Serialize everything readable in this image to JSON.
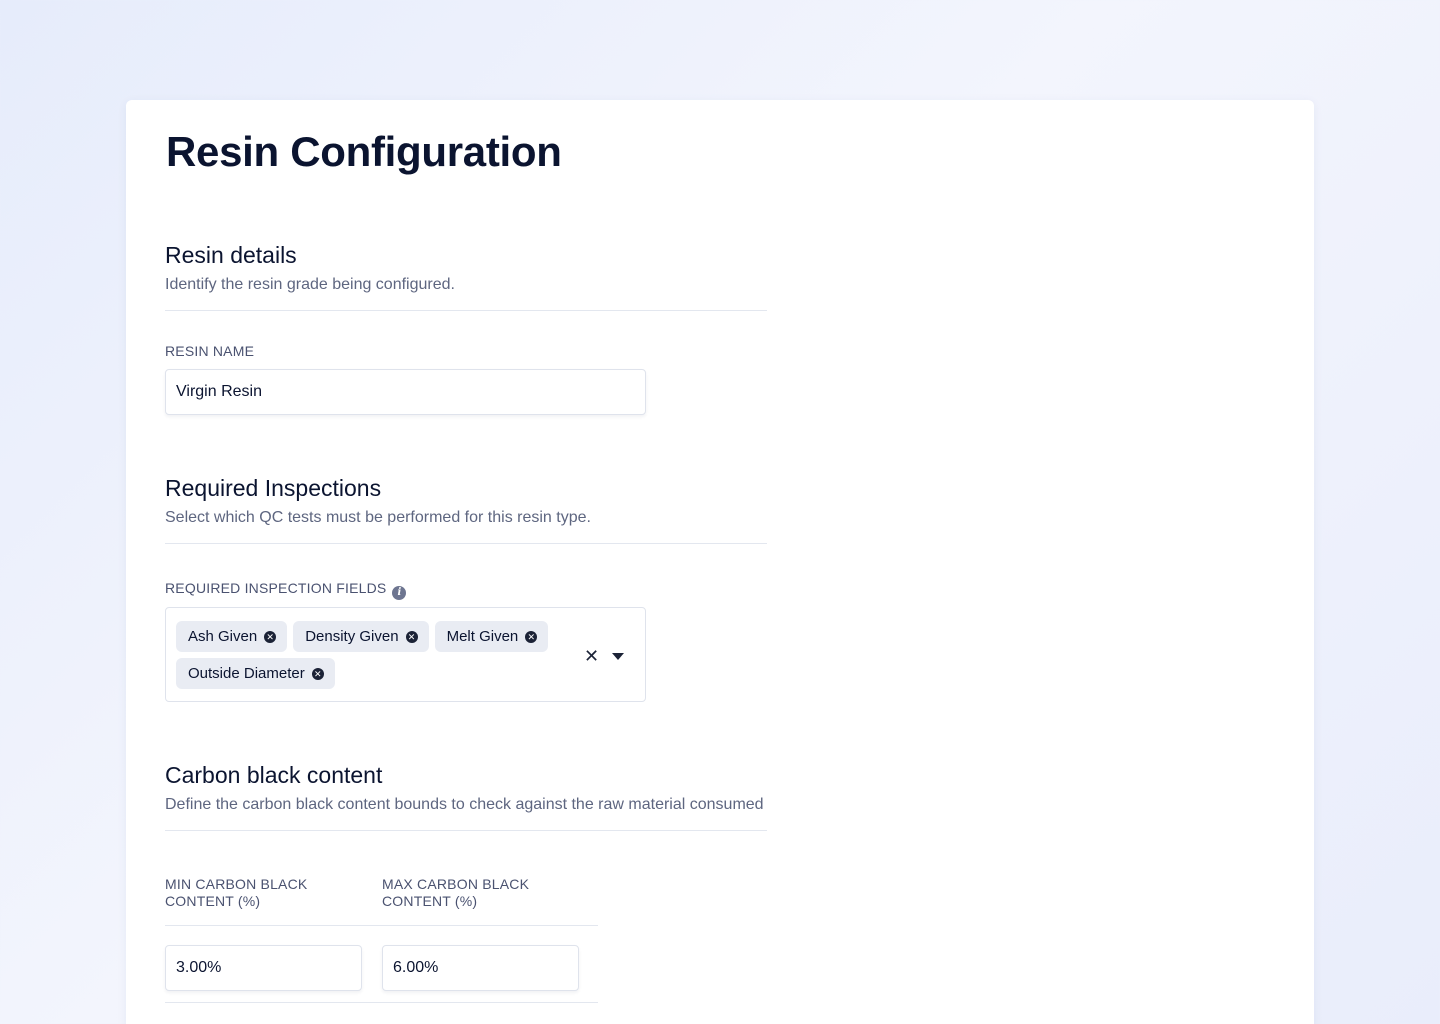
{
  "page": {
    "title": "Resin Configuration"
  },
  "resin_details": {
    "title": "Resin details",
    "description": "Identify the resin grade being configured.",
    "name_label": "RESIN NAME",
    "name_value": "Virgin Resin"
  },
  "required_inspections": {
    "title": "Required Inspections",
    "description": "Select which QC tests must be performed for this resin type.",
    "fields_label": "REQUIRED INSPECTION FIELDS",
    "selected": [
      {
        "label": "Ash Given"
      },
      {
        "label": "Density Given"
      },
      {
        "label": "Melt Given"
      },
      {
        "label": "Outside Diameter"
      }
    ],
    "icons": {
      "info": "info-icon",
      "clear": "clear-icon",
      "dropdown": "chevron-down-icon",
      "remove": "remove-chip-icon"
    }
  },
  "carbon_black": {
    "title": "Carbon black content",
    "description": "Define the carbon black content bounds to check against the raw material consumed",
    "min_label": "MIN CARBON BLACK CONTENT (%)",
    "max_label": "MAX CARBON BLACK CONTENT (%)",
    "min_value": "3.00%",
    "max_value": "6.00%"
  },
  "colors": {
    "background": "#e9edfb",
    "card": "#ffffff",
    "text_primary": "#0b1430",
    "text_secondary": "#5e6680",
    "chip_background": "#e9ecf3"
  }
}
